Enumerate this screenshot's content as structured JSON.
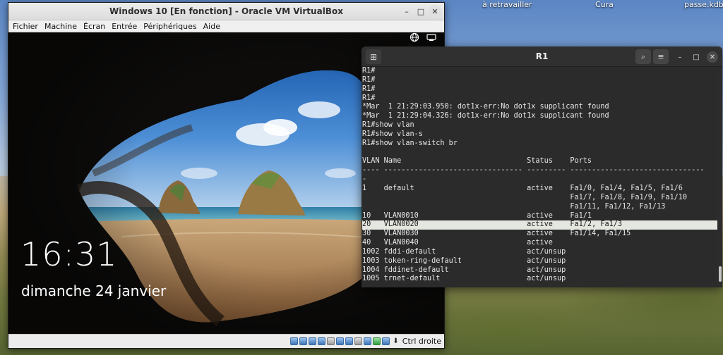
{
  "desktop": {
    "icons": [
      {
        "label": "à retravailler"
      },
      {
        "label": "Cura"
      },
      {
        "label": "passe.kdbx"
      }
    ]
  },
  "vbox": {
    "title": "Windows 10 [En fonction] - Oracle VM VirtualBox",
    "menu": [
      "Fichier",
      "Machine",
      "Écran",
      "Entrée",
      "Périphériques",
      "Aide"
    ],
    "lock_screen": {
      "time": "16:31",
      "date": "dimanche 24 janvier"
    },
    "host_key": "Ctrl droite"
  },
  "terminal": {
    "title": "R1",
    "lines": [
      "R1#",
      "R1#",
      "R1#",
      "R1#",
      "*Mar  1 21:29:03.950: dot1x-err:No dot1x supplicant found",
      "*Mar  1 21:29:04.326: dot1x-err:No dot1x supplicant found",
      "R1#show vlan",
      "R1#show vlan-s",
      "R1#show vlan-switch br",
      "",
      "VLAN Name                             Status    Ports",
      "---- -------------------------------- --------- -------------------------------",
      "-",
      "1    default                          active    Fa1/0, Fa1/4, Fa1/5, Fa1/6",
      "                                                Fa1/7, Fa1/8, Fa1/9, Fa1/10",
      "                                                Fa1/11, Fa1/12, Fa1/13",
      "10   VLAN0010                         active    Fa1/1",
      "20   VLAN0020                         active    Fa1/2, Fa1/3",
      "30   VLAN0030                         active    Fa1/14, Fa1/15",
      "40   VLAN0040                         active",
      "1002 fddi-default                     act/unsup",
      "1003 token-ring-default               act/unsup",
      "1004 fddinet-default                  act/unsup",
      "1005 trnet-default                    act/unsup"
    ]
  }
}
